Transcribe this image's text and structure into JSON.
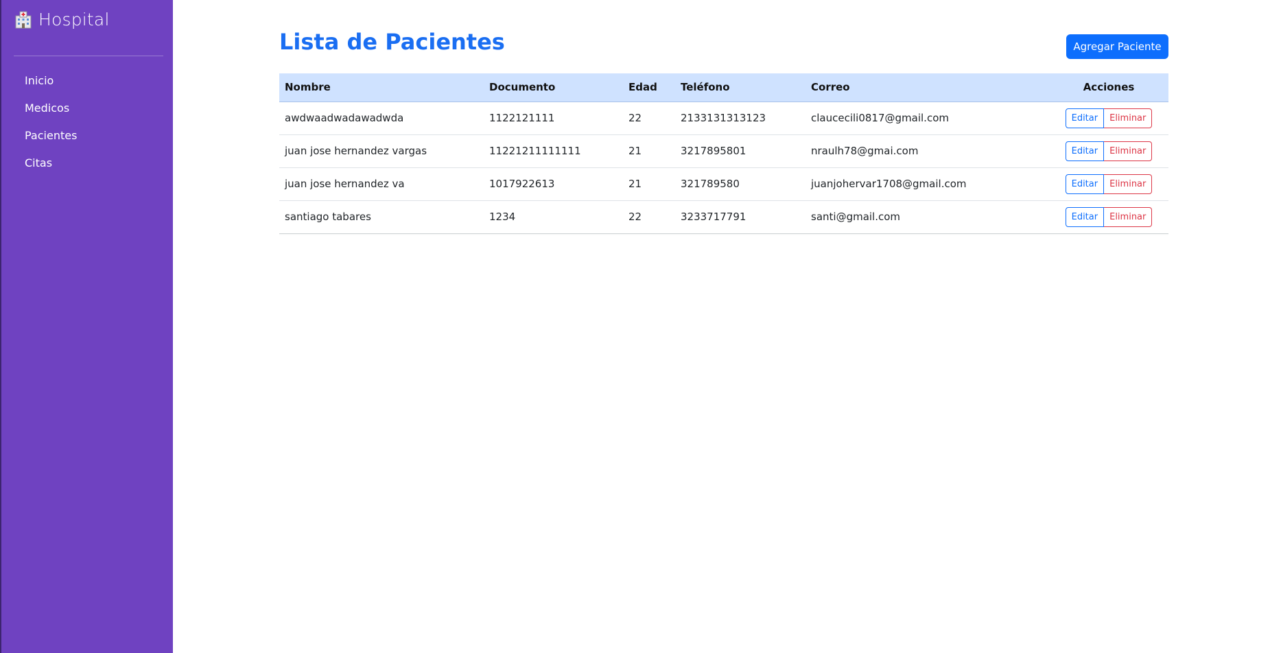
{
  "sidebar": {
    "brand": "Hospital",
    "items": [
      {
        "label": "Inicio"
      },
      {
        "label": "Medicos"
      },
      {
        "label": "Pacientes"
      },
      {
        "label": "Citas"
      }
    ],
    "color": "#6f42c1"
  },
  "main": {
    "title": "Lista de Pacientes",
    "add_button": "Agregar Paciente",
    "table": {
      "headers": [
        "Nombre",
        "Documento",
        "Edad",
        "Teléfono",
        "Correo",
        "Acciones"
      ],
      "rows": [
        {
          "nombre": "awdwaadwadawadwda",
          "documento": "1122121111",
          "edad": "22",
          "telefono": "2133131313123",
          "correo": "claucecili0817@gmail.com"
        },
        {
          "nombre": "juan jose hernandez vargas",
          "documento": "11221211111111",
          "edad": "21",
          "telefono": "3217895801",
          "correo": "nraulh78@gmai.com"
        },
        {
          "nombre": "juan jose hernandez va",
          "documento": "1017922613",
          "edad": "21",
          "telefono": "321789580",
          "correo": "juanjohervar1708@gmail.com"
        },
        {
          "nombre": "santiago tabares",
          "documento": "1234",
          "edad": "22",
          "telefono": "3233717791",
          "correo": "santi@gmail.com"
        }
      ],
      "edit_label": "Editar",
      "delete_label": "Eliminar"
    }
  },
  "colors": {
    "primary": "#0d6efd",
    "title": "#1a6ef2",
    "danger": "#dc3545",
    "header_bg": "#cfe2ff"
  },
  "icons": {
    "brand": "hospital-icon"
  }
}
